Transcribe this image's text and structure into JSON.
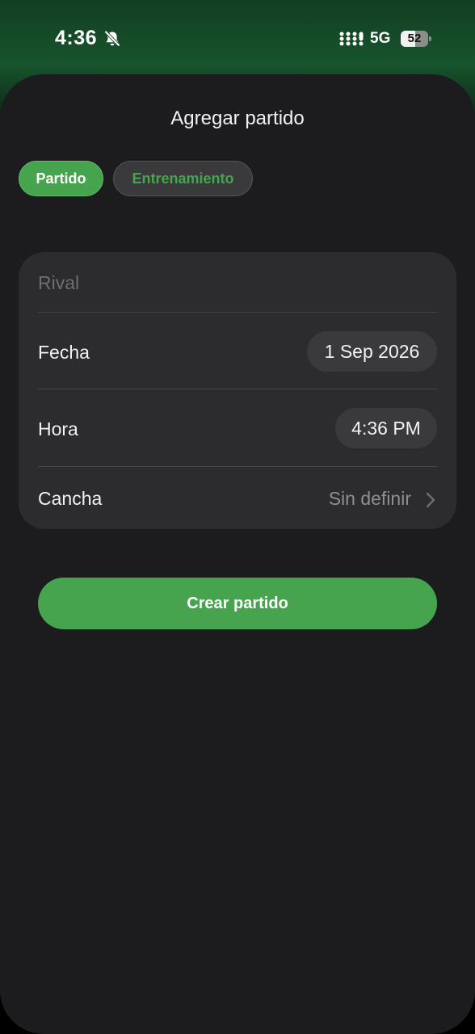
{
  "status_bar": {
    "time": "4:36",
    "network": "5G",
    "battery": "52",
    "battery_level": 0.52,
    "icons": [
      "bell-slash-icon",
      "signal-icon",
      "battery-icon"
    ]
  },
  "sheet": {
    "title": "Agregar partido"
  },
  "segments": {
    "partido": "Partido",
    "entrenamiento": "Entrenamiento",
    "selected": "Partido"
  },
  "form": {
    "rival_placeholder": "Rival",
    "rival_value": "",
    "fecha_label": "Fecha",
    "fecha_value": "1 Sep 2026",
    "hora_label": "Hora",
    "hora_value": "4:36 PM",
    "cancha_label": "Cancha",
    "cancha_value": "Sin definir"
  },
  "actions": {
    "create_label": "Crear partido"
  },
  "colors": {
    "accent": "#45a44d",
    "sheet_background": "#1c1c1e",
    "card_background": "#2c2c2e",
    "pill_background": "#3a3a3c"
  }
}
